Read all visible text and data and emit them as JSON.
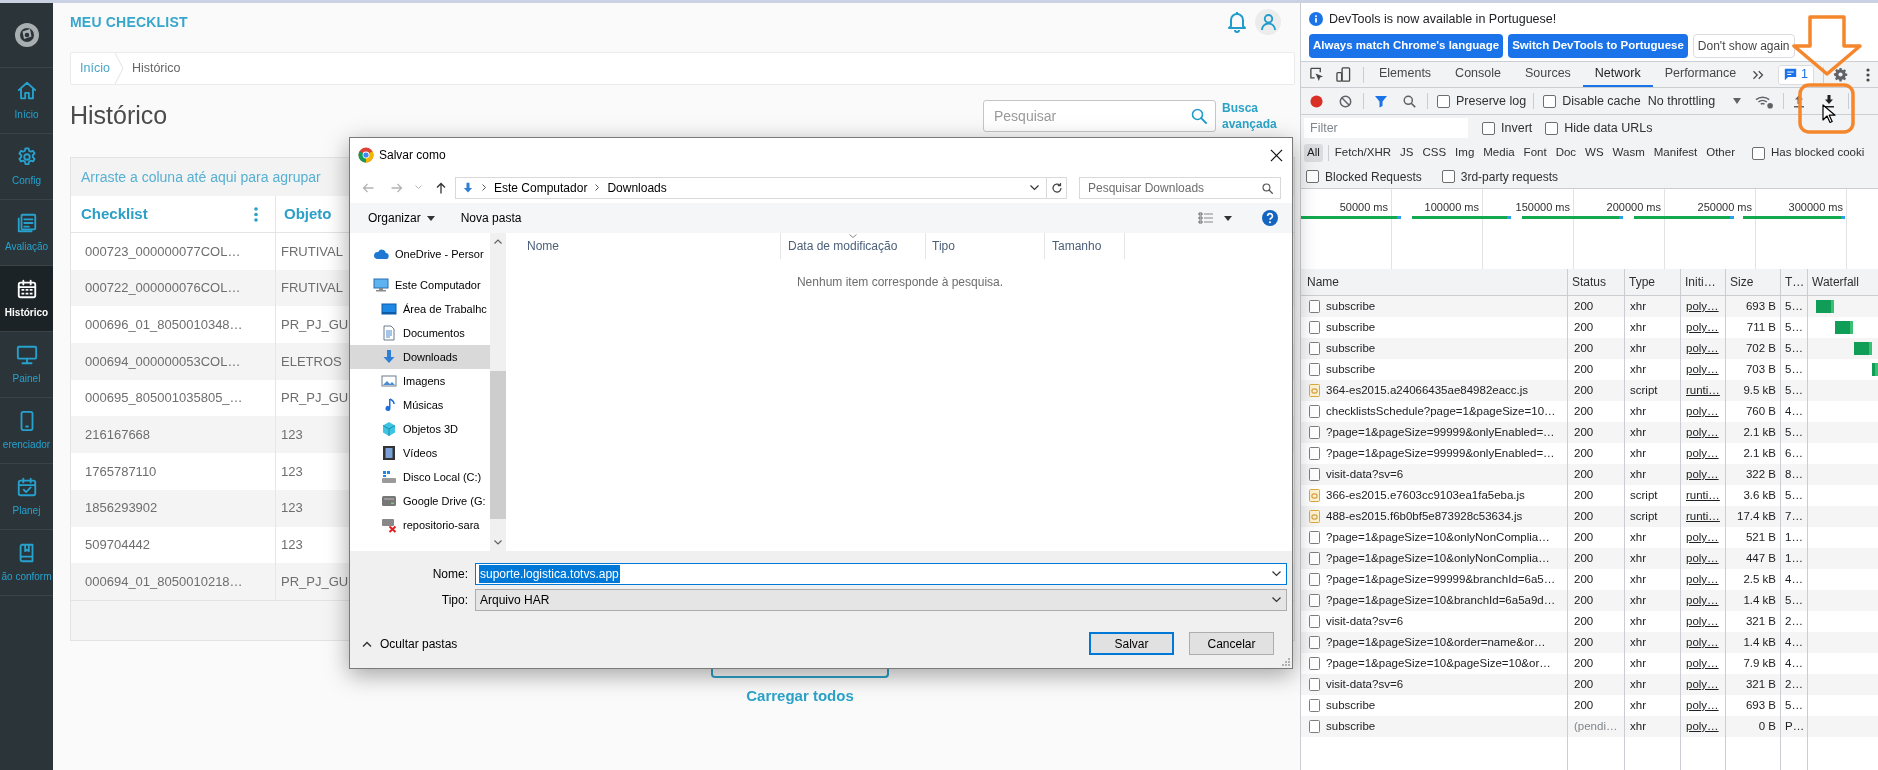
{
  "app": {
    "sidebar": {
      "items": [
        {
          "label": "Início",
          "selected": false
        },
        {
          "label": "Config",
          "selected": false
        },
        {
          "label": "Avaliação",
          "selected": false
        },
        {
          "label": "Histórico",
          "selected": true
        },
        {
          "label": "Painel",
          "selected": false
        },
        {
          "label": "erenciador",
          "selected": false
        },
        {
          "label": "Planej",
          "selected": false
        },
        {
          "label": "ão conform",
          "selected": false
        }
      ]
    },
    "header": {
      "title": "MEU CHECKLIST"
    },
    "breadcrumb": [
      {
        "label": "Início",
        "selected": false
      },
      {
        "label": "Histórico",
        "selected": true
      }
    ],
    "page_title": "Histórico",
    "search": {
      "placeholder": "Pesquisar"
    },
    "advanced_search": "Busca avançada",
    "grid": {
      "group_hint": "Arraste a coluna até aqui para agrupar",
      "columns": [
        "Checklist",
        "Objeto"
      ],
      "rows": [
        [
          "000723_000000077COL…",
          "FRUTIVAL"
        ],
        [
          "000722_000000076COL…",
          "FRUTIVAL"
        ],
        [
          "000696_01_8050010348…",
          "PR_PJ_GU"
        ],
        [
          "000694_000000053COL…",
          "ELETROS"
        ],
        [
          "000695_805001035805_…",
          "PR_PJ_GU"
        ],
        [
          "216167668",
          "123"
        ],
        [
          "1765787110",
          "123"
        ],
        [
          "1856293902",
          "123"
        ],
        [
          "509704442",
          "123"
        ],
        [
          "000694_01_8050010218…",
          "PR_PJ_GU"
        ]
      ]
    },
    "load_all": "Carregar todos"
  },
  "save_dialog": {
    "title": "Salvar como",
    "path": [
      "Este Computador",
      "Downloads"
    ],
    "search": {
      "placeholder": "Pesquisar Downloads"
    },
    "toolbar": {
      "organize": "Organizar",
      "new_folder": "Nova pasta"
    },
    "folders": [
      {
        "label": "OneDrive - Persor",
        "selected": false
      },
      {
        "label": "Este Computador",
        "selected": false,
        "children": [
          {
            "label": "Área de Trabalhc",
            "selected": false
          },
          {
            "label": "Documentos",
            "selected": false
          },
          {
            "label": "Downloads",
            "selected": true
          },
          {
            "label": "Imagens",
            "selected": false
          },
          {
            "label": "Músicas",
            "selected": false
          },
          {
            "label": "Objetos 3D",
            "selected": false
          },
          {
            "label": "Vídeos",
            "selected": false
          },
          {
            "label": "Disco Local (C:)",
            "selected": false
          },
          {
            "label": "Google Drive (G:",
            "selected": false
          },
          {
            "label": "repositorio-sara",
            "selected": false
          }
        ]
      }
    ],
    "columns": [
      "Nome",
      "Data de modificação",
      "Tipo",
      "Tamanho"
    ],
    "empty_message": "Nenhum item corresponde à pesquisa.",
    "file_name": {
      "label": "Nome:",
      "value": "suporte.logistica.totvs.app",
      "text_selected": true
    },
    "file_type": {
      "label": "Tipo:",
      "value": "Arquivo HAR"
    },
    "hide_folders": "Ocultar pastas",
    "buttons": [
      {
        "label": "Salvar",
        "default": true
      },
      {
        "label": "Cancelar",
        "default": false
      }
    ]
  },
  "devtools": {
    "infobar": {
      "message": "DevTools is now available in Portuguese!",
      "buttons": [
        {
          "label": "Always match Chrome's language",
          "primary": true
        },
        {
          "label": "Switch DevTools to Portuguese",
          "primary": true
        },
        {
          "label": "Don't show again",
          "primary": false
        }
      ]
    },
    "tabs": [
      {
        "label": "Elements",
        "selected": false
      },
      {
        "label": "Console",
        "selected": false
      },
      {
        "label": "Sources",
        "selected": false
      },
      {
        "label": "Network",
        "selected": true
      },
      {
        "label": "Performance",
        "selected": false
      }
    ],
    "issues_count": "1",
    "toolbar": {
      "recording": true,
      "preserve_log": {
        "label": "Preserve log",
        "checked": false
      },
      "disable_cache": {
        "label": "Disable cache",
        "checked": false
      },
      "throttling": "No throttling"
    },
    "filter": {
      "placeholder": "Filter",
      "invert": {
        "label": "Invert",
        "checked": false
      },
      "hide_data_urls": {
        "label": "Hide data URLs",
        "checked": false
      }
    },
    "type_filters": [
      {
        "label": "All",
        "selected": true
      },
      {
        "label": "Fetch/XHR",
        "selected": false
      },
      {
        "label": "JS",
        "selected": false
      },
      {
        "label": "CSS",
        "selected": false
      },
      {
        "label": "Img",
        "selected": false
      },
      {
        "label": "Media",
        "selected": false
      },
      {
        "label": "Font",
        "selected": false
      },
      {
        "label": "Doc",
        "selected": false
      },
      {
        "label": "WS",
        "selected": false
      },
      {
        "label": "Wasm",
        "selected": false
      },
      {
        "label": "Manifest",
        "selected": false
      },
      {
        "label": "Other",
        "selected": false
      }
    ],
    "has_blocked_cookies": {
      "label": "Has blocked cooki",
      "checked": false
    },
    "blocked_requests": {
      "label": "Blocked Requests",
      "checked": false
    },
    "third_party_requests": {
      "label": "3rd-party requests",
      "checked": false
    },
    "overview": {
      "ticks": [
        "50000 ms",
        "100000 ms",
        "150000 ms",
        "200000 ms",
        "250000 ms",
        "300000 ms"
      ]
    },
    "requests": {
      "columns": [
        "Name",
        "Status",
        "Type",
        "Initi…",
        "Size",
        "T…",
        "Waterfall"
      ],
      "rows": [
        {
          "name": "subscribe",
          "status": "200",
          "type": "xhr",
          "initiator": "poly…",
          "size": "693 B",
          "time": "5…",
          "kind": "xhr",
          "pending": false,
          "waterfall_bar": true
        },
        {
          "name": "subscribe",
          "status": "200",
          "type": "xhr",
          "initiator": "poly…",
          "size": "711 B",
          "time": "5…",
          "kind": "xhr",
          "pending": false,
          "waterfall_bar": true
        },
        {
          "name": "subscribe",
          "status": "200",
          "type": "xhr",
          "initiator": "poly…",
          "size": "702 B",
          "time": "5…",
          "kind": "xhr",
          "pending": false,
          "waterfall_bar": true
        },
        {
          "name": "subscribe",
          "status": "200",
          "type": "xhr",
          "initiator": "poly…",
          "size": "703 B",
          "time": "5…",
          "kind": "xhr",
          "pending": false,
          "waterfall_bar": true
        },
        {
          "name": "364-es2015.a24066435ae84982eacc.js",
          "status": "200",
          "type": "script",
          "initiator": "runti…",
          "size": "9.5 kB",
          "time": "5…",
          "kind": "script",
          "pending": false,
          "waterfall_bar": false
        },
        {
          "name": "checklistsSchedule?page=1&pageSize=10…",
          "status": "200",
          "type": "xhr",
          "initiator": "poly…",
          "size": "760 B",
          "time": "4…",
          "kind": "xhr",
          "pending": false,
          "waterfall_bar": false
        },
        {
          "name": "?page=1&pageSize=99999&onlyEnabled=…",
          "status": "200",
          "type": "xhr",
          "initiator": "poly…",
          "size": "2.1 kB",
          "time": "5…",
          "kind": "xhr",
          "pending": false,
          "waterfall_bar": false
        },
        {
          "name": "?page=1&pageSize=99999&onlyEnabled=…",
          "status": "200",
          "type": "xhr",
          "initiator": "poly…",
          "size": "2.1 kB",
          "time": "6…",
          "kind": "xhr",
          "pending": false,
          "waterfall_bar": false
        },
        {
          "name": "visit-data?sv=6",
          "status": "200",
          "type": "xhr",
          "initiator": "poly…",
          "size": "322 B",
          "time": "8…",
          "kind": "xhr",
          "pending": false,
          "waterfall_bar": false
        },
        {
          "name": "366-es2015.e7603cc9103ea1fa5eba.js",
          "status": "200",
          "type": "script",
          "initiator": "runti…",
          "size": "3.6 kB",
          "time": "5…",
          "kind": "script",
          "pending": false,
          "waterfall_bar": false
        },
        {
          "name": "488-es2015.f6b0bf5e873928c53634.js",
          "status": "200",
          "type": "script",
          "initiator": "runti…",
          "size": "17.4 kB",
          "time": "7…",
          "kind": "script",
          "pending": false,
          "waterfall_bar": false
        },
        {
          "name": "?page=1&pageSize=10&onlyNonComplia…",
          "status": "200",
          "type": "xhr",
          "initiator": "poly…",
          "size": "521 B",
          "time": "1…",
          "kind": "xhr",
          "pending": false,
          "waterfall_bar": false
        },
        {
          "name": "?page=1&pageSize=10&onlyNonComplia…",
          "status": "200",
          "type": "xhr",
          "initiator": "poly…",
          "size": "447 B",
          "time": "1…",
          "kind": "xhr",
          "pending": false,
          "waterfall_bar": false
        },
        {
          "name": "?page=1&pageSize=99999&branchId=6a5…",
          "status": "200",
          "type": "xhr",
          "initiator": "poly…",
          "size": "2.5 kB",
          "time": "4…",
          "kind": "xhr",
          "pending": false,
          "waterfall_bar": false
        },
        {
          "name": "?page=1&pageSize=10&branchId=6a5a9d…",
          "status": "200",
          "type": "xhr",
          "initiator": "poly…",
          "size": "1.4 kB",
          "time": "5…",
          "kind": "xhr",
          "pending": false,
          "waterfall_bar": false
        },
        {
          "name": "visit-data?sv=6",
          "status": "200",
          "type": "xhr",
          "initiator": "poly…",
          "size": "321 B",
          "time": "2…",
          "kind": "xhr",
          "pending": false,
          "waterfall_bar": false
        },
        {
          "name": "?page=1&pageSize=10&order=name&or…",
          "status": "200",
          "type": "xhr",
          "initiator": "poly…",
          "size": "1.4 kB",
          "time": "4…",
          "kind": "xhr",
          "pending": false,
          "waterfall_bar": false
        },
        {
          "name": "?page=1&pageSize=10&pageSize=10&or…",
          "status": "200",
          "type": "xhr",
          "initiator": "poly…",
          "size": "7.9 kB",
          "time": "4…",
          "kind": "xhr",
          "pending": false,
          "waterfall_bar": false
        },
        {
          "name": "visit-data?sv=6",
          "status": "200",
          "type": "xhr",
          "initiator": "poly…",
          "size": "321 B",
          "time": "2…",
          "kind": "xhr",
          "pending": false,
          "waterfall_bar": false
        },
        {
          "name": "subscribe",
          "status": "200",
          "type": "xhr",
          "initiator": "poly…",
          "size": "693 B",
          "time": "5…",
          "kind": "xhr",
          "pending": false,
          "waterfall_bar": false
        },
        {
          "name": "subscribe",
          "status": "(pendi…",
          "type": "xhr",
          "initiator": "poly…",
          "size": "0 B",
          "time": "P…",
          "kind": "xhr",
          "pending": true,
          "waterfall_bar": false
        }
      ]
    }
  }
}
